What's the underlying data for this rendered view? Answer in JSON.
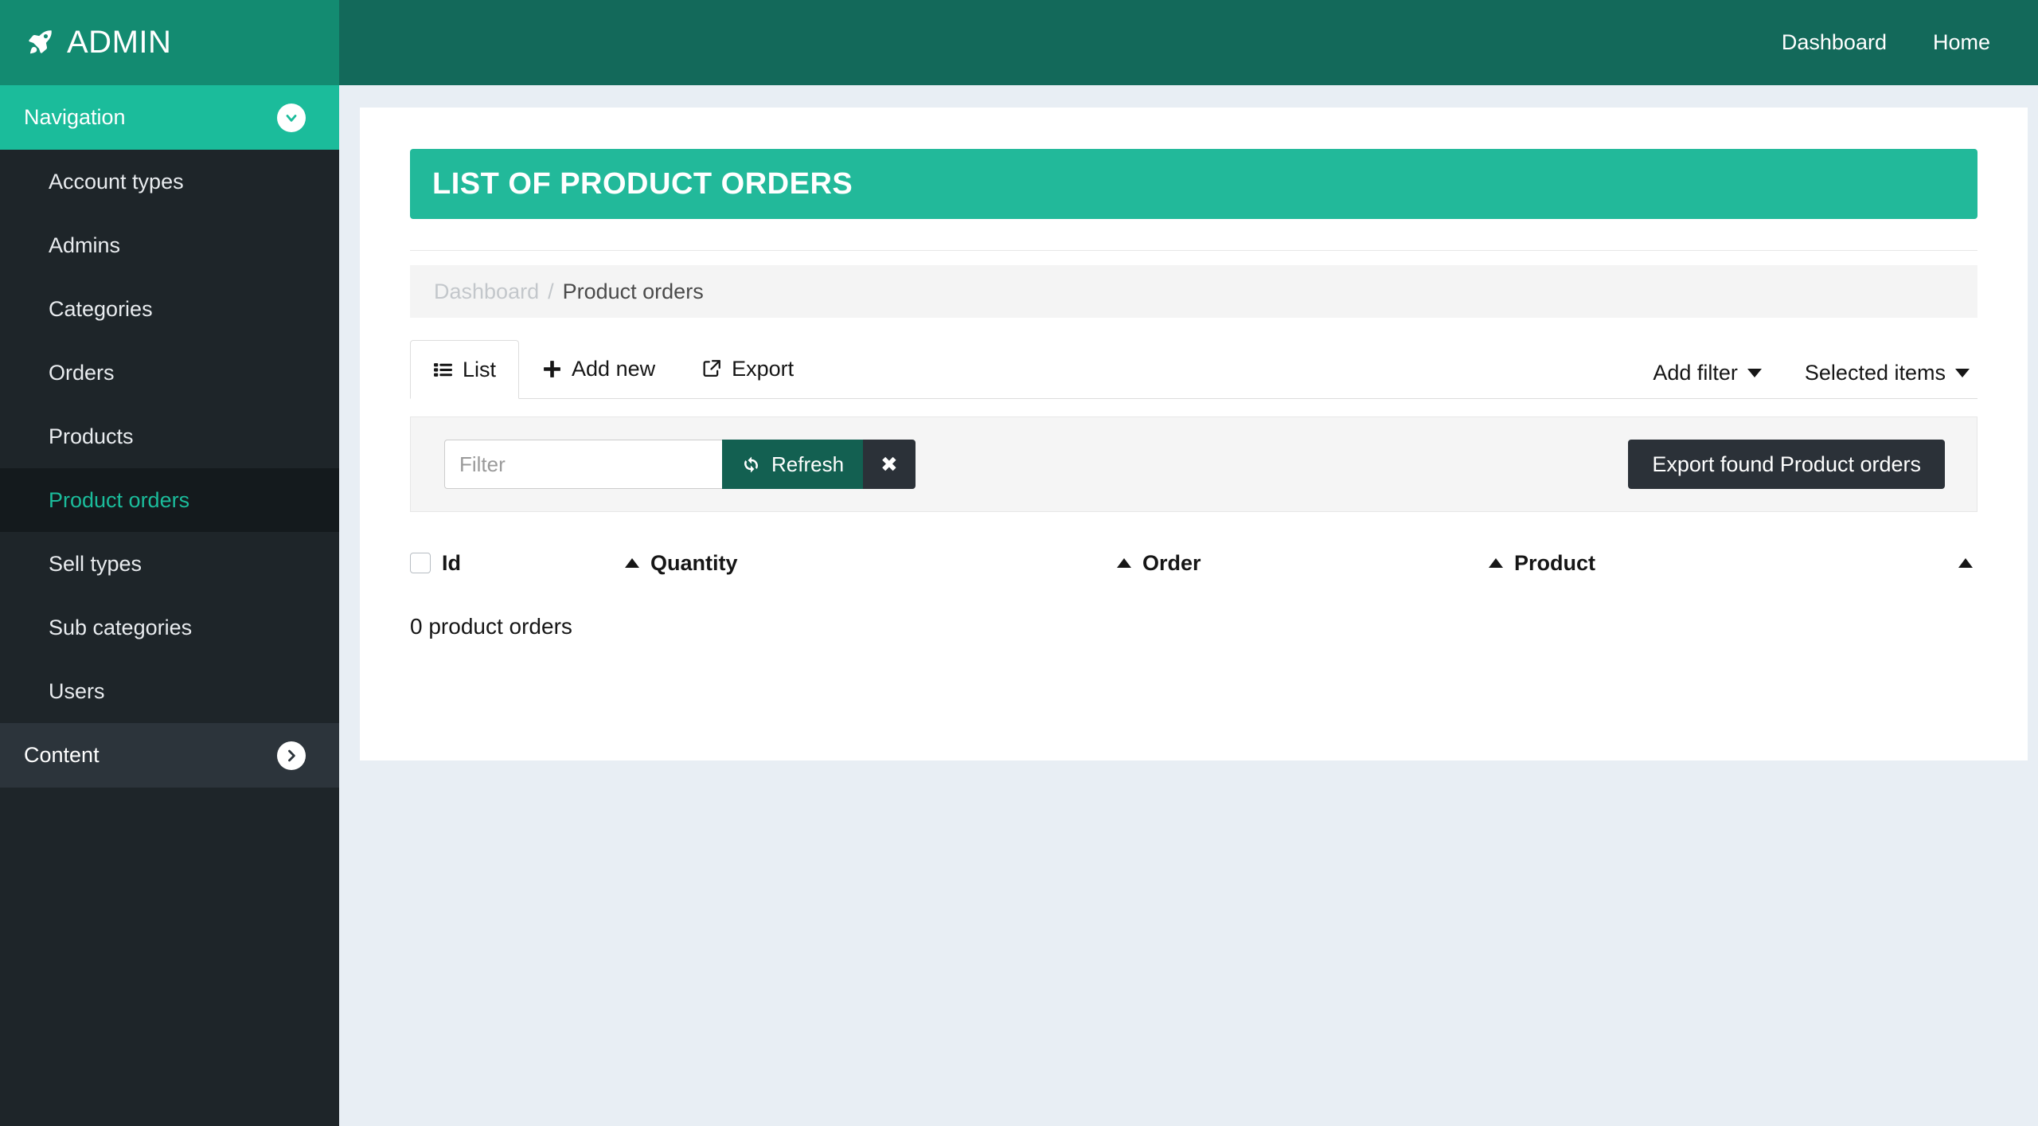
{
  "topbar": {
    "brand_label": "ADMIN",
    "brand_icon": "rocket-icon",
    "links": [
      {
        "label": "Dashboard"
      },
      {
        "label": "Home"
      }
    ]
  },
  "sidebar": {
    "sections": [
      {
        "label": "Navigation",
        "state": "open",
        "chevron_icon": "chevron-down-icon",
        "items": [
          {
            "label": "Account types",
            "active": false
          },
          {
            "label": "Admins",
            "active": false
          },
          {
            "label": "Categories",
            "active": false
          },
          {
            "label": "Orders",
            "active": false
          },
          {
            "label": "Products",
            "active": false
          },
          {
            "label": "Product orders",
            "active": true
          },
          {
            "label": "Sell types",
            "active": false
          },
          {
            "label": "Sub categories",
            "active": false
          },
          {
            "label": "Users",
            "active": false
          }
        ]
      },
      {
        "label": "Content",
        "state": "closed",
        "chevron_icon": "chevron-right-icon",
        "items": []
      }
    ]
  },
  "main": {
    "panel_title": "LIST OF PRODUCT ORDERS",
    "breadcrumb": {
      "parent": "Dashboard",
      "separator": "/",
      "current": "Product orders"
    },
    "tabs": [
      {
        "label": "List",
        "icon": "list-icon",
        "active": true
      },
      {
        "label": "Add new",
        "icon": "plus-icon",
        "active": false
      },
      {
        "label": "Export",
        "icon": "share-export-icon",
        "active": false
      }
    ],
    "dropdowns": [
      {
        "label": "Add filter",
        "icon": "caret-down-icon"
      },
      {
        "label": "Selected items",
        "icon": "caret-down-icon"
      }
    ],
    "filterbar": {
      "input_value": "",
      "input_placeholder": "Filter",
      "refresh_label": "Refresh",
      "refresh_icon": "refresh-icon",
      "clear_label": "✖",
      "clear_icon": "close-icon",
      "export_found_label": "Export found Product orders"
    },
    "table": {
      "columns": [
        {
          "label": "Id",
          "sortable": false
        },
        {
          "label": "Quantity",
          "sortable": true,
          "sort": "asc"
        },
        {
          "label": "Order",
          "sortable": true,
          "sort": "asc"
        },
        {
          "label": "Product",
          "sortable": true,
          "sort": "asc"
        }
      ],
      "trailing_sort_icon": "sort-asc-icon",
      "select_all_checked": false,
      "empty_text": "0 product orders"
    }
  },
  "colors": {
    "brand_teal": "#138b71",
    "topbar_dark_teal": "#13695a",
    "accent_teal": "#1bbc9b",
    "panel_teal": "#22b99a",
    "sidebar_dark": "#1e2529",
    "sidebar_active": "#141a1d",
    "page_bg": "#e8eef4",
    "button_dark": "#2b3138",
    "refresh_green": "#136051"
  }
}
